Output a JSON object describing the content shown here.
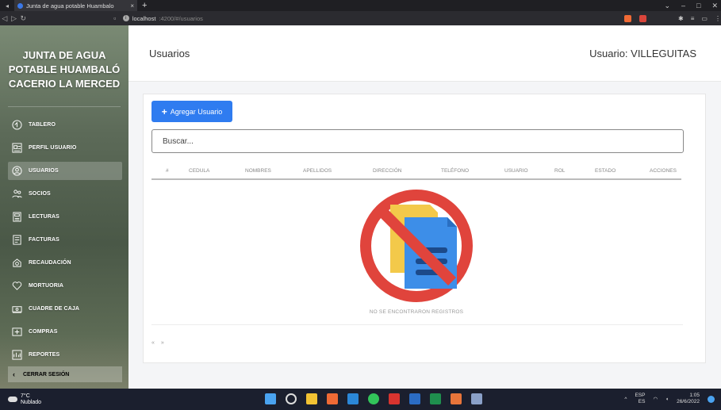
{
  "browser": {
    "tab_title": "Junta de agua potable Huambalo",
    "tab_close": "×",
    "new_tab": "+",
    "url_host": "localhost",
    "url_path": ":4200/#/usuarios"
  },
  "sidebar": {
    "brand_lines": [
      "JUNTA DE AGUA",
      "POTABLE HUAMBALÓ",
      "CACERIO LA MERCED"
    ],
    "items": [
      {
        "label": "TABLERO",
        "icon": "dashboard-icon"
      },
      {
        "label": "PERFIL USUARIO",
        "icon": "profile-card-icon"
      },
      {
        "label": "USUARIOS",
        "icon": "users-icon",
        "active": true
      },
      {
        "label": "SOCIOS",
        "icon": "group-icon"
      },
      {
        "label": "LECTURAS",
        "icon": "meter-icon"
      },
      {
        "label": "FACTURAS",
        "icon": "invoice-icon"
      },
      {
        "label": "RECAUDACIÓN",
        "icon": "collection-icon"
      },
      {
        "label": "MORTUORIA",
        "icon": "heart-icon"
      },
      {
        "label": "CUADRE DE CAJA",
        "icon": "cashbox-icon"
      },
      {
        "label": "COMPRAS",
        "icon": "cart-icon"
      },
      {
        "label": "REPORTES",
        "icon": "reports-icon"
      }
    ],
    "logout": "CERRAR SESIÓN"
  },
  "header": {
    "title": "Usuarios",
    "user": "Usuario: VILLEGUITAS"
  },
  "main": {
    "add_button": "Agregar Usuario",
    "search_placeholder": "Buscar...",
    "columns": [
      "#",
      "CEDULA",
      "NOMBRES",
      "APELLIDOS",
      "DIRECCIÓN",
      "TELÉFONO",
      "USUARIO",
      "ROL",
      "ESTADO",
      "ACCIONES"
    ],
    "empty_message": "NO SE ENCONTRARON REGISTROS",
    "pager_prev": "«",
    "pager_next": "»"
  },
  "taskbar": {
    "temp": "7°C",
    "weather": "Nublado",
    "lang": "ESP",
    "lang2": "ES",
    "time": "1:05",
    "date": "26/6/2022"
  },
  "colors": {
    "accent": "#2f7cf0",
    "no_sign": "#e0443c",
    "doc_back": "#f3c94a",
    "doc_front": "#3d8ee8"
  }
}
